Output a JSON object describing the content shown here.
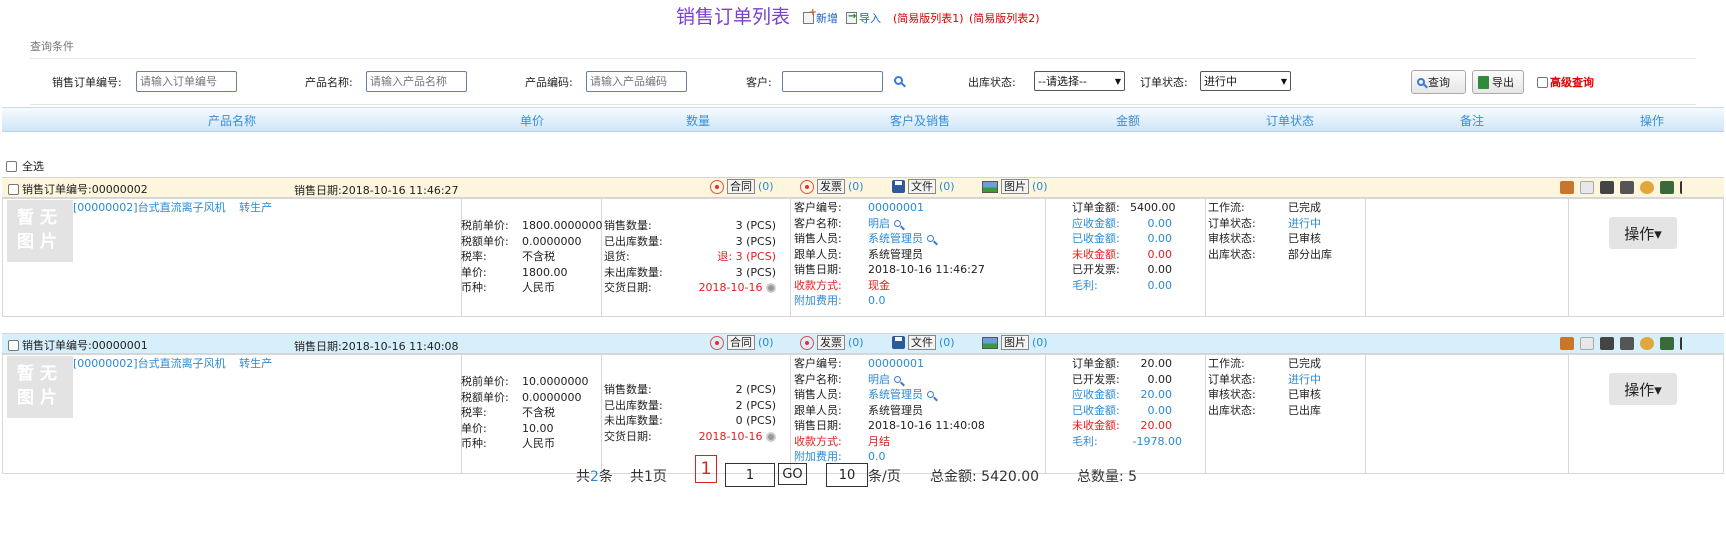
{
  "header": {
    "title": "销售订单列表",
    "add_label": "新增",
    "import_label": "导入",
    "simple_list1": "(简易版列表1)",
    "simple_list2": "(简易版列表2)"
  },
  "query": {
    "section_title": "查询条件",
    "order_no_label": "销售订单编号:",
    "order_no_placeholder": "请输入订单编号",
    "product_name_label": "产品名称:",
    "product_name_placeholder": "请输入产品名称",
    "product_code_label": "产品编码:",
    "product_code_placeholder": "请输入产品编码",
    "customer_label": "客户:",
    "customer_value": "",
    "stock_status_label": "出库状态:",
    "stock_status_value": "--请选择--",
    "order_status_label": "订单状态:",
    "order_status_value": "进行中",
    "search_button": "查询",
    "export_button": "导出",
    "advanced_label": "高级查询"
  },
  "table": {
    "columns": [
      "产品名称",
      "单价",
      "数量",
      "客户及销售",
      "金额",
      "订单状态",
      "备注",
      "操作"
    ],
    "select_all": "全选"
  },
  "orders": [
    {
      "order_no": "销售订单编号:00000002",
      "sale_date": "销售日期:2018-10-16 11:46:27",
      "contract": "合同",
      "contract_count": "(0)",
      "invoice": "发票",
      "invoice_count": "(0)",
      "file": "文件",
      "file_count": "(0)",
      "image": "图片",
      "image_count": "(0)",
      "no_image": "暂无图片",
      "product": "[00000002]台式直流离子风机",
      "product_tag": "转生产",
      "price_lines": [
        [
          "税前单价:",
          "1800.0000000"
        ],
        [
          "税额单价:",
          "0.0000000"
        ],
        [
          "税率:",
          "不含税"
        ],
        [
          "单价:",
          "1800.00"
        ],
        [
          "币种:",
          "人民币"
        ]
      ],
      "qty_lines": [
        [
          "销售数量:",
          "3 (PCS)"
        ],
        [
          "已出库数量:",
          "3 (PCS)"
        ],
        [
          "退货:",
          "退: 3 (PCS)"
        ],
        [
          "未出库数量:",
          "3 (PCS)"
        ]
      ],
      "delivery_label": "交货日期:",
      "delivery_date": "2018-10-16",
      "customer_lines": [
        [
          "客户编号:",
          "00000001"
        ],
        [
          "客户名称:",
          "明启"
        ],
        [
          "销售人员:",
          "系统管理员"
        ],
        [
          "跟单人员:",
          "系统管理员"
        ],
        [
          "销售日期:",
          "2018-10-16 11:46:27"
        ],
        [
          "收款方式:",
          "现金"
        ],
        [
          "附加费用:",
          "0.0"
        ]
      ],
      "amount_lines": [
        [
          "订单金额:",
          "5400.00"
        ],
        [
          "应收金额:",
          "0.00"
        ],
        [
          "已收金额:",
          "0.00"
        ],
        [
          "未收金额:",
          "0.00"
        ],
        [
          "已开发票:",
          "0.00"
        ],
        [
          "毛利:",
          "0.00"
        ]
      ],
      "status_lines": [
        [
          "工作流:",
          "已完成"
        ],
        [
          "订单状态:",
          "进行中"
        ],
        [
          "审核状态:",
          "已审核"
        ],
        [
          "出库状态:",
          "部分出库"
        ]
      ],
      "op_button": "操作▾"
    },
    {
      "order_no": "销售订单编号:00000001",
      "sale_date": "销售日期:2018-10-16 11:40:08",
      "contract": "合同",
      "contract_count": "(0)",
      "invoice": "发票",
      "invoice_count": "(0)",
      "file": "文件",
      "file_count": "(0)",
      "image": "图片",
      "image_count": "(0)",
      "no_image": "暂无图片",
      "product": "[00000002]台式直流离子风机",
      "product_tag": "转生产",
      "price_lines": [
        [
          "税前单价:",
          "10.0000000"
        ],
        [
          "税额单价:",
          "0.0000000"
        ],
        [
          "税率:",
          "不含税"
        ],
        [
          "单价:",
          "10.00"
        ],
        [
          "币种:",
          "人民币"
        ]
      ],
      "qty_lines": [
        [
          "销售数量:",
          "2 (PCS)"
        ],
        [
          "已出库数量:",
          "2 (PCS)"
        ],
        [
          "未出库数量:",
          "0 (PCS)"
        ]
      ],
      "delivery_label": "交货日期:",
      "delivery_date": "2018-10-16",
      "customer_lines": [
        [
          "客户编号:",
          "00000001"
        ],
        [
          "客户名称:",
          "明启"
        ],
        [
          "销售人员:",
          "系统管理员"
        ],
        [
          "跟单人员:",
          "系统管理员"
        ],
        [
          "销售日期:",
          "2018-10-16 11:40:08"
        ],
        [
          "收款方式:",
          "月结"
        ],
        [
          "附加费用:",
          "0.0"
        ]
      ],
      "amount_lines": [
        [
          "订单金额:",
          "20.00"
        ],
        [
          "已开发票:",
          "0.00"
        ],
        [
          "应收金额:",
          "20.00"
        ],
        [
          "已收金额:",
          "0.00"
        ],
        [
          "未收金额:",
          "20.00"
        ],
        [
          "毛利:",
          "-1978.00"
        ]
      ],
      "status_lines": [
        [
          "工作流:",
          "已完成"
        ],
        [
          "订单状态:",
          "进行中"
        ],
        [
          "审核状态:",
          "已审核"
        ],
        [
          "出库状态:",
          "已出库"
        ]
      ],
      "op_button": "操作▾"
    }
  ],
  "pagination": {
    "total_prefix": "共",
    "total_items": "2",
    "total_items_suffix": "条",
    "total_pages": "共1页",
    "current_page": "1",
    "page_input": "1",
    "go_label": "GO",
    "page_size": "10",
    "page_size_suffix": "条/页",
    "total_amount": "总金额: 5420.00",
    "total_qty": "总数量: 5"
  }
}
